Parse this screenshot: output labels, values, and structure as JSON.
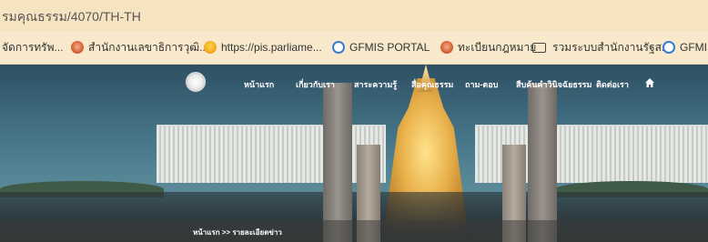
{
  "browser": {
    "url": "รมคุณธรรม/4070/TH-TH",
    "bookmarks": [
      {
        "label": "จัดการทรัพ...",
        "icon": "none"
      },
      {
        "label": "สำนักงานเลขาธิการวุฒิ...",
        "icon": "seal-icon"
      },
      {
        "label": "https://pis.parliame...",
        "icon": "smiley-icon"
      },
      {
        "label": "GFMIS PORTAL",
        "icon": "globe-icon"
      },
      {
        "label": "ทะเบียนกฎหมาย",
        "icon": "seal-icon"
      },
      {
        "label": "รวมระบบสำนักงานรัฐส...",
        "icon": "folder-icon"
      },
      {
        "label": "GFMIS",
        "icon": "globe-icon"
      }
    ]
  },
  "site": {
    "nav": [
      "หน้าแรก",
      "เกี่ยวกับเรา",
      "สาระความรู้",
      "สื่อคุณธรรม",
      "ถาม-ตอบ",
      "สืบค้นคำวินิจฉัยธรรม",
      "ติดต่อเรา"
    ],
    "breadcrumb": "หน้าแรก >> รายละเอียดข่าว"
  },
  "colors": {
    "browser_bg": "#f6e4c1",
    "nav_text": "#ffffff"
  }
}
